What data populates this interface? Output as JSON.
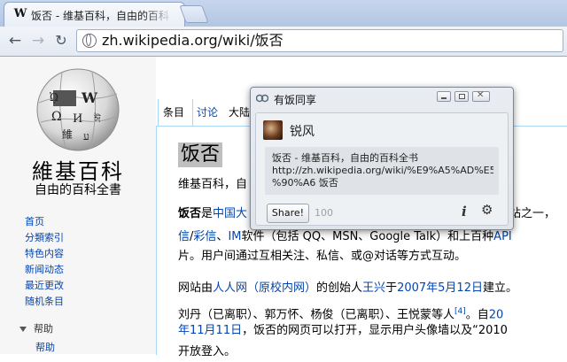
{
  "browser": {
    "tab_title": "饭否 - 维基百科，自由的百科",
    "tab_favicon": "W",
    "url": "zh.wikipedia.org/wiki/饭否"
  },
  "icons": {
    "back": "back-arrow-icon",
    "forward": "forward-arrow-icon",
    "reload": "reload-icon",
    "globe": "globe-icon",
    "info": "info-icon",
    "gear": "gear-icon"
  },
  "sidebar": {
    "site_name": "維基百科",
    "tagline": "自由的百科全書",
    "nav_items": [
      "首页",
      "分類索引",
      "特色内容",
      "新闻动态",
      "最近更改",
      "随机条目"
    ],
    "help_heading": "帮助",
    "help_item": "帮助"
  },
  "page_tabs": {
    "article": "条目",
    "talk": "讨论",
    "variant": "大陆"
  },
  "article": {
    "title": "饭否",
    "subtitle": "维基百科，自",
    "p1_l1_bold": "饭否",
    "p1_l1_a": "是",
    "p1_l1_link": "中国大",
    "p1_l1_end": "站之一，",
    "p1_l2_link1": "信",
    "p1_l2_sep": "/",
    "p1_l2_link2": "彩信",
    "p1_l2_b": "、",
    "p1_l2_link3": "IM",
    "p1_l2_c": "软件（包括 QQ、MSN、Google Talk）和上百种",
    "p1_l2_link4": "API",
    "p1_l3": "片。用户间通过互相关注、私信、或@对话等方式互动。",
    "p2_l1_a": "网站由",
    "p2_l1_link1": "人人网（原校内网）",
    "p2_l1_b": "的创始人",
    "p2_l1_link2": "王兴",
    "p2_l1_c": "于",
    "p2_l1_link3": "2007年5月12日",
    "p2_l1_d": "建立。",
    "p2_l2_a": "刘丹（已离职）、郭万怀、杨俊（已离职）、王悦蒙等人",
    "p2_l2_sup": "[4]",
    "p2_l2_b": "。自",
    "p2_l2_link": "20",
    "p2_l3_link": "年11月11日",
    "p2_l3_b": "，饭否的网页可以打开，显示用户头像墙以及“2010",
    "p2_l4": "开放登入。"
  },
  "popup": {
    "title": "有饭同享",
    "username": "锐风",
    "message": "饭否 - 维基百科，自由的百科全书\nhttp://zh.wikipedia.org/wiki/%E9%A5%AD%E5\n%90%A6 饭否",
    "share_label": "Share!",
    "char_count": "100",
    "info_glyph": "i",
    "gear_glyph": "⚙"
  }
}
